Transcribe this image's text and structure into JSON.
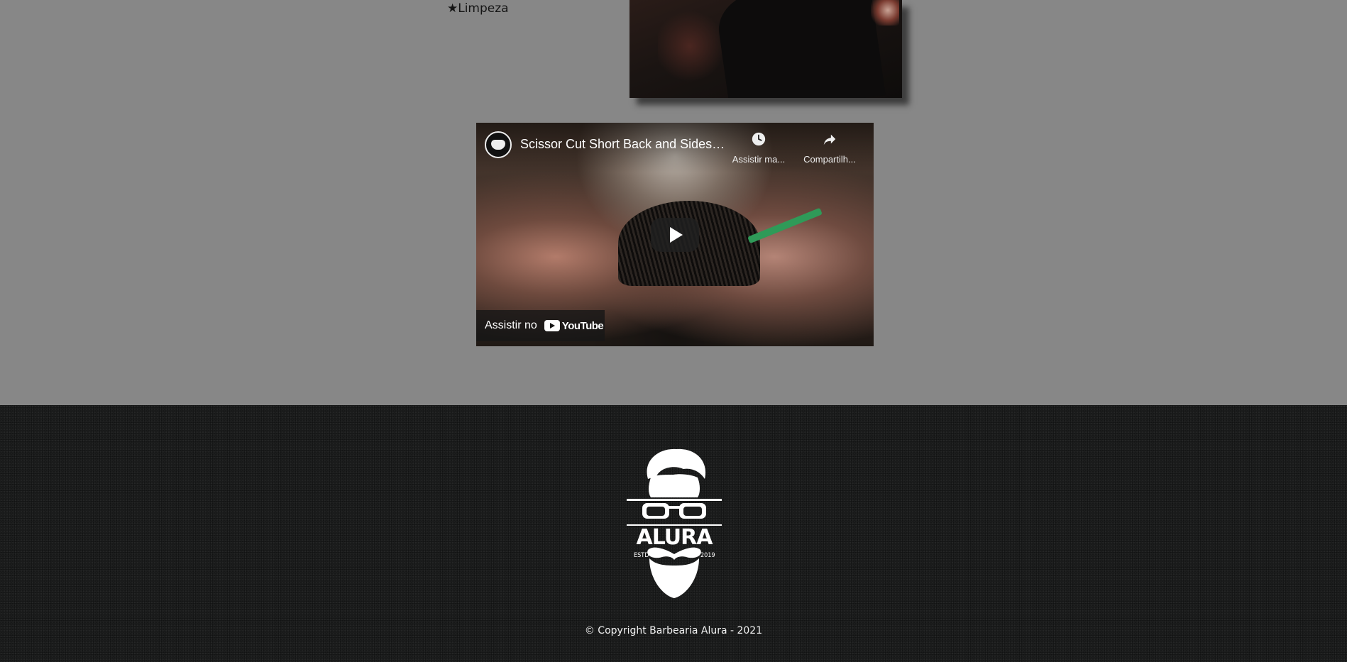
{
  "benefits": {
    "item": "★Limpeza"
  },
  "video": {
    "title": "Scissor Cut Short Back and Sides ...",
    "watch_later_label": "Assistir ma...",
    "share_label": "Compartilh...",
    "watch_on_label": "Assistir no",
    "platform_label": "YouTube"
  },
  "footer": {
    "logo_text": "ALURA",
    "logo_left_small": "ESTD",
    "logo_right_small": "2019",
    "copyright": "© Copyright Barbearia Alura - 2021"
  }
}
